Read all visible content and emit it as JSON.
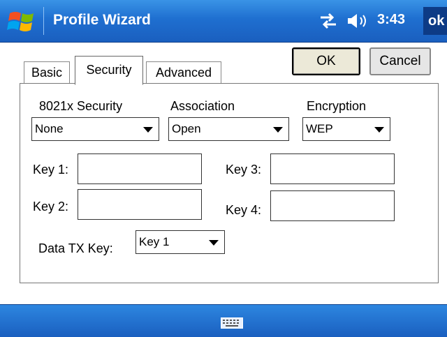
{
  "titlebar": {
    "title": "Profile Wizard",
    "clock": "3:43",
    "ok_label": "ok"
  },
  "dialog": {
    "ok_label": "OK",
    "cancel_label": "Cancel"
  },
  "tabs": [
    {
      "label": "Basic",
      "active": false
    },
    {
      "label": "Security",
      "active": true
    },
    {
      "label": "Advanced",
      "active": false
    }
  ],
  "security": {
    "security_label": "8021x Security",
    "security_value": "None",
    "association_label": "Association",
    "association_value": "Open",
    "encryption_label": "Encryption",
    "encryption_value": "WEP",
    "key1_label": "Key 1:",
    "key1_value": "",
    "key2_label": "Key 2:",
    "key2_value": "",
    "key3_label": "Key 3:",
    "key3_value": "",
    "key4_label": "Key 4:",
    "key4_value": "",
    "tx_key_label": "Data TX Key:",
    "tx_key_value": "Key 1"
  },
  "icons": {
    "start": "windows-flag-icon",
    "connectivity": "connectivity-arrows-icon",
    "volume": "speaker-icon",
    "input_panel": "keyboard-icon"
  },
  "colors": {
    "titlebar": "#1f6fd0",
    "ok_badge": "#0d3b86",
    "button_face": "#ece9d8"
  }
}
